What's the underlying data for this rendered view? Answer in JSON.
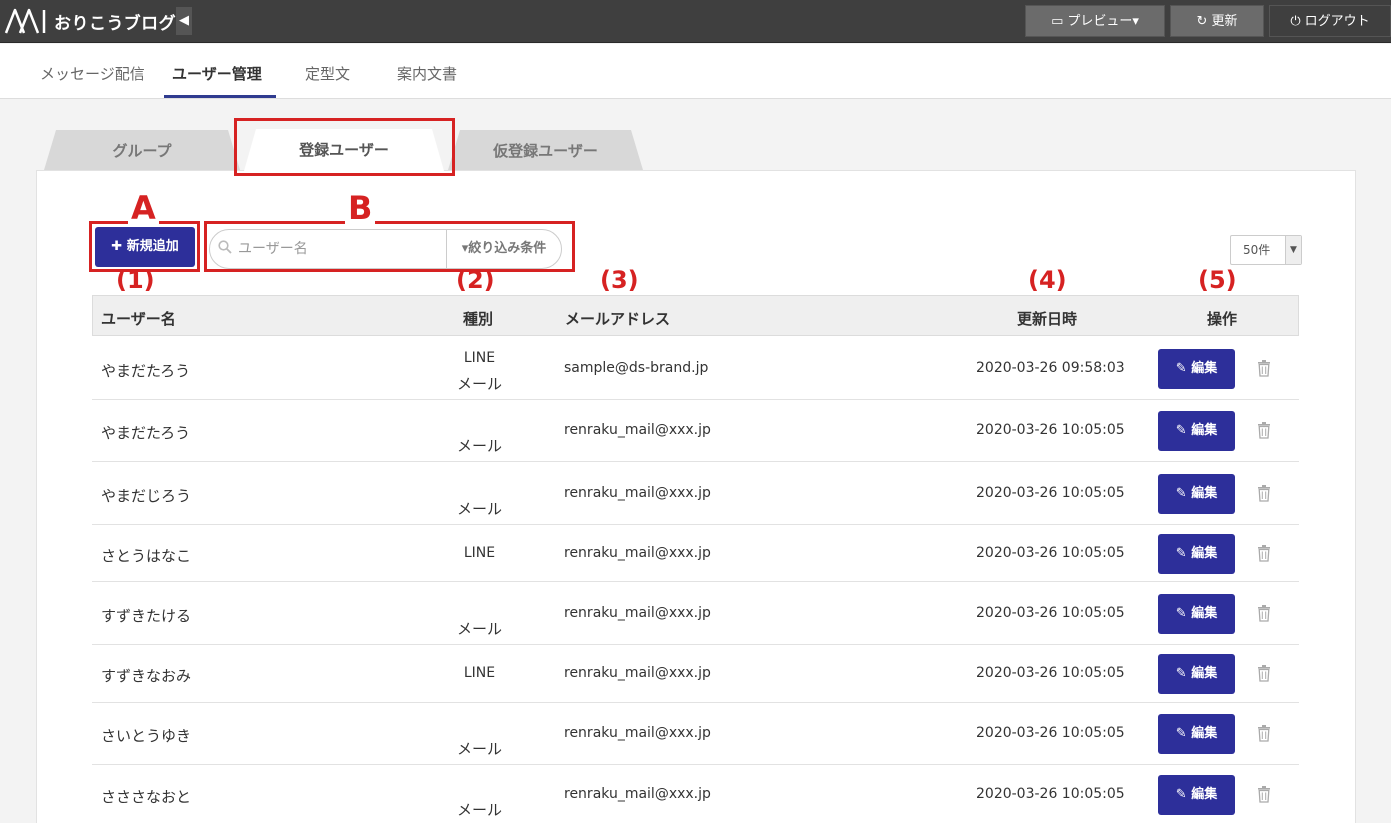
{
  "header": {
    "app_name": "おりこうブログ",
    "collapse": "◀",
    "preview": "プレビュー▾",
    "refresh": "更新",
    "logout": "ログアウト"
  },
  "nav": {
    "items": [
      "メッセージ配信",
      "ユーザー管理",
      "定型文",
      "案内文書"
    ],
    "active_index": 1
  },
  "tabs": [
    "グループ",
    "登録ユーザー",
    "仮登録ユーザー"
  ],
  "toolbar": {
    "add_label": "✚ 新規追加",
    "search_placeholder": "ユーザー名",
    "filter_label": "▾絞り込み条件",
    "per_page": "50件"
  },
  "annotations": {
    "A": "A",
    "B": "B",
    "n1": "(1)",
    "n2": "(2)",
    "n3": "(3)",
    "n4": "(4)",
    "n5": "(5)"
  },
  "table": {
    "headers": [
      "ユーザー名",
      "種別",
      "メールアドレス",
      "更新日時",
      "操作"
    ],
    "edit_label": "編集",
    "rows": [
      {
        "name": "やまだたろう",
        "type_top": "LINE",
        "type_bottom": "メール",
        "email": "sample@ds-brand.jp",
        "updated": "2020-03-26 09:58:03"
      },
      {
        "name": "やまだたろう",
        "type_top": "",
        "type_bottom": "メール",
        "email": "renraku_mail@xxx.jp",
        "updated": "2020-03-26 10:05:05"
      },
      {
        "name": "やまだじろう",
        "type_top": "",
        "type_bottom": "メール",
        "email": "renraku_mail@xxx.jp",
        "updated": "2020-03-26 10:05:05"
      },
      {
        "name": "さとうはなこ",
        "type_top": "LINE",
        "type_bottom": "",
        "email": "renraku_mail@xxx.jp",
        "updated": "2020-03-26 10:05:05"
      },
      {
        "name": "すずきたける",
        "type_top": "",
        "type_bottom": "メール",
        "email": "renraku_mail@xxx.jp",
        "updated": "2020-03-26 10:05:05"
      },
      {
        "name": "すずきなおみ",
        "type_top": "LINE",
        "type_bottom": "",
        "email": "renraku_mail@xxx.jp",
        "updated": "2020-03-26 10:05:05"
      },
      {
        "name": "さいとうゆき",
        "type_top": "",
        "type_bottom": "メール",
        "email": "renraku_mail@xxx.jp",
        "updated": "2020-03-26 10:05:05"
      },
      {
        "name": "さささなおと",
        "type_top": "",
        "type_bottom": "メール",
        "email": "renraku_mail@xxx.jp",
        "updated": "2020-03-26 10:05:05"
      }
    ]
  },
  "colors": {
    "primary": "#2d2f9a",
    "annotation": "#d62222",
    "topbar": "#3f3f3f"
  }
}
